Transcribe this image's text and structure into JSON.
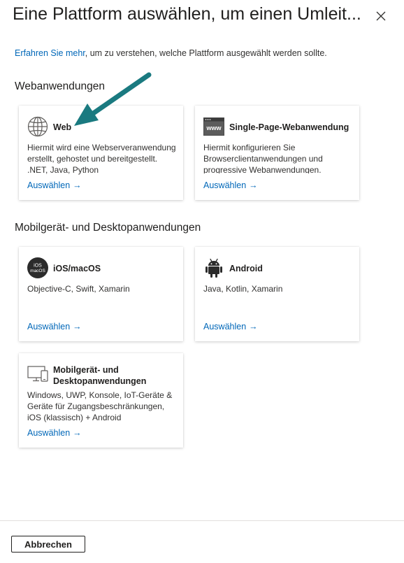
{
  "panel": {
    "title": "Eine Plattform auswählen, um einen Umleit...",
    "close_icon": "close-icon"
  },
  "intro": {
    "link_text": "Erfahren Sie mehr",
    "text": ", um zu verstehen, welche Plattform ausgewählt werden sollte."
  },
  "sections": {
    "web": {
      "heading": "Webanwendungen",
      "cards": [
        {
          "icon": "globe-icon",
          "title": "Web",
          "description": "Hiermit wird eine Webserveranwendung erstellt, gehostet und bereitgestellt. .NET, Java, Python",
          "link": "Auswählen"
        },
        {
          "icon": "www-browser-icon",
          "icon_text": "www",
          "title": "Single-Page-Webanwendung",
          "description": "Hiermit konfigurieren Sie Browserclientanwendungen und progressive Webanwendungen. JavaScript.",
          "link": "Auswählen"
        }
      ]
    },
    "mobile": {
      "heading": "Mobilgerät- und Desktopanwendungen",
      "cards": [
        {
          "icon": "ios-macos-icon",
          "icon_text_top": "iOS",
          "icon_text_bottom": "macOS",
          "title": "iOS/macOS",
          "description": "Objective-C, Swift, Xamarin",
          "link": "Auswählen"
        },
        {
          "icon": "android-icon",
          "title": "Android",
          "description": "Java, Kotlin, Xamarin",
          "link": "Auswählen"
        },
        {
          "icon": "desktop-mobile-icon",
          "title": "Mobilgerät- und Desktopanwendungen",
          "description": "Windows, UWP, Konsole, IoT-Geräte & Geräte für Zugangsbeschränkungen, iOS (klassisch) + Android",
          "link": "Auswählen"
        }
      ]
    }
  },
  "link_arrow": "→",
  "footer": {
    "cancel_label": "Abbrechen"
  },
  "annotation": {
    "icon": "pointer-arrow-icon",
    "color": "#1a7a80"
  },
  "colors": {
    "link": "#0067b8",
    "text": "#201f1e"
  }
}
